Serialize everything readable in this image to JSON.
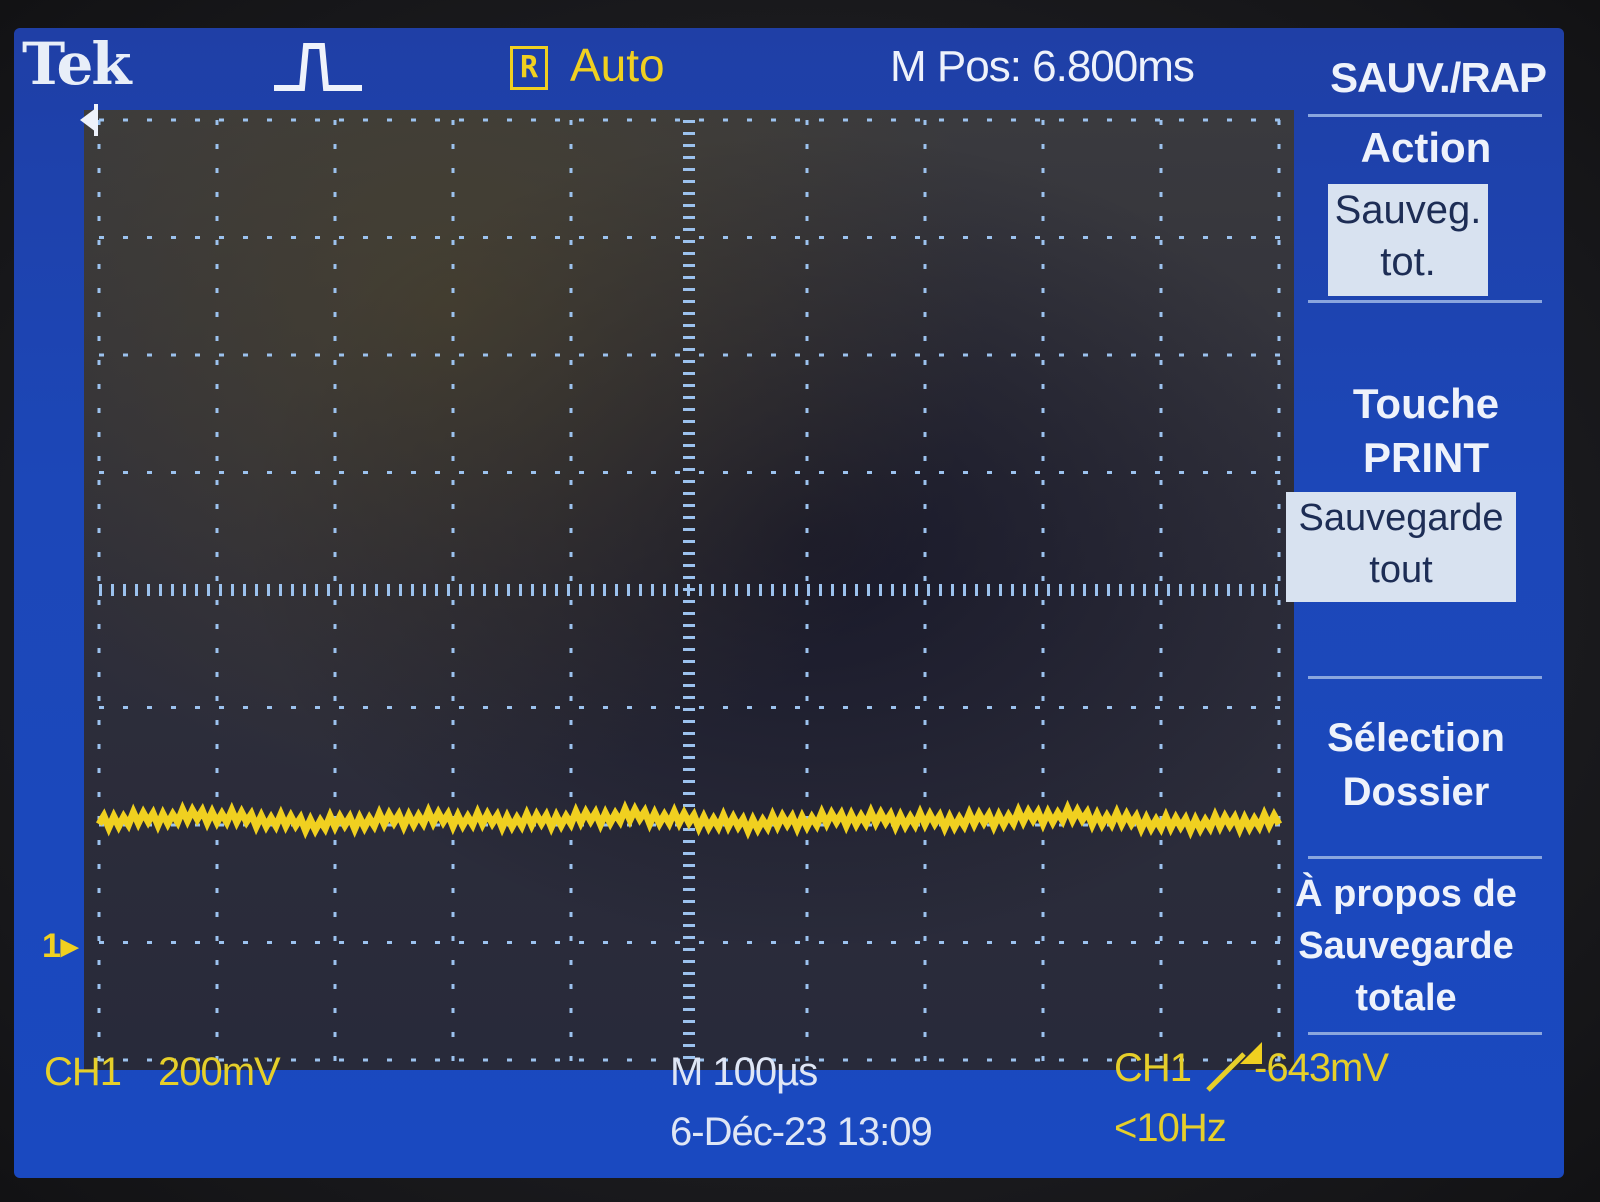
{
  "header": {
    "brand": "Tek",
    "acquisition_icon": "pulse-waveform-icon",
    "run_badge": "R",
    "run_state": "Auto",
    "horizontal_position": "M Pos: 6.800ms"
  },
  "channel_marker": "1",
  "channel_marker_icon": "channel-arrow-icon",
  "trigger_position_icon": "trigger-position-arrow-icon",
  "trigger_level_icon": "trigger-level-arrow-icon",
  "footer": {
    "ch1_label": "CH1",
    "ch1_scale": "200mV",
    "timebase": "M 100µs",
    "datetime": "6-Déc-23 13:09",
    "trigger_source": "CH1",
    "trigger_slope_icon": "rising-edge-icon",
    "trigger_level": "-643mV",
    "frequency": "<10Hz"
  },
  "menu": {
    "title": "SAUV./RAP",
    "items": [
      {
        "label_lines": [
          "Action"
        ],
        "box_lines": [
          "Sauveg.",
          "tot."
        ]
      },
      {
        "label_lines": [
          "Touche",
          "PRINT"
        ],
        "box_lines": [
          "Sauvegarde",
          "tout"
        ]
      },
      {
        "label_lines": [
          "Sélection",
          "Dossier"
        ],
        "box_lines": []
      },
      {
        "label_lines": [
          "À propos de",
          "Sauvegarde",
          "totale"
        ],
        "box_lines": []
      }
    ]
  },
  "colors": {
    "screen_blue": "#1c47b8",
    "trace_yellow": "#f0d020",
    "grid_dots": "#9cc2ee"
  },
  "chart_data": {
    "type": "line",
    "series": [
      {
        "values": [
          -0.82,
          -0.8,
          -0.83,
          -0.81,
          -0.82,
          -0.8,
          -0.83,
          -0.81,
          -0.82,
          -0.8,
          -0.83,
          -0.82
        ]
      }
    ],
    "xlabel": "",
    "ylabel": "",
    "grid": true
  }
}
